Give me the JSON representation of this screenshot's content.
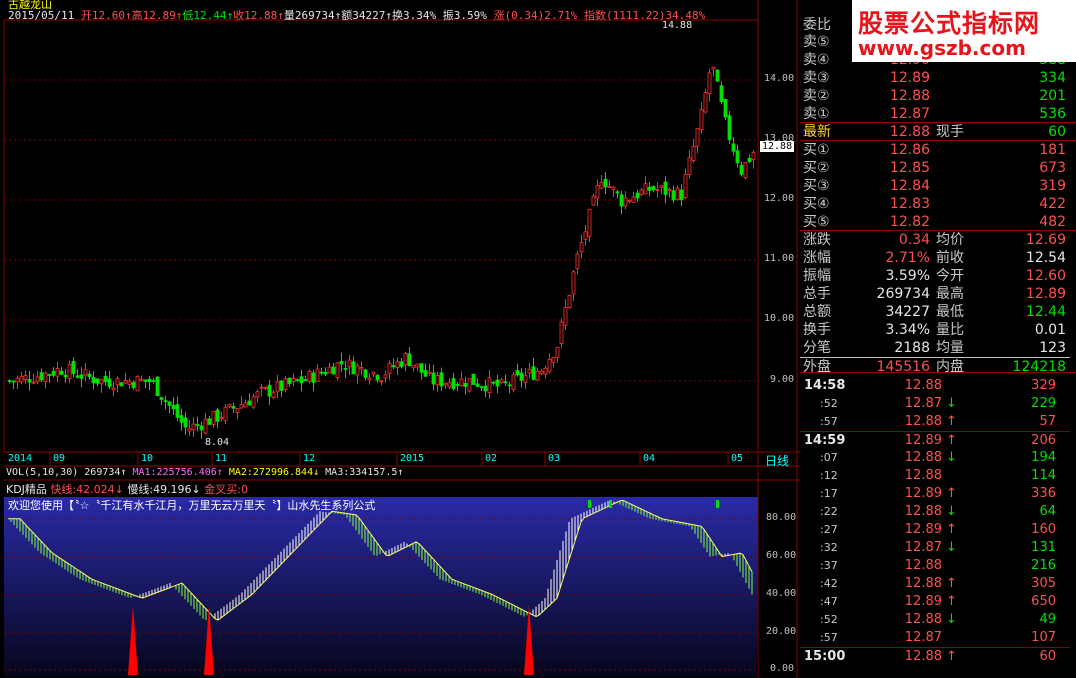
{
  "app_title": "古越龙山",
  "quote_line": {
    "date": "2015/05/11",
    "open": "开12.60↑",
    "high": "高12.89↑",
    "low": "低12.44↑",
    "close": "收12.88↑",
    "volume": "量269734↑",
    "amount": "额34227↑",
    "turnover": "换3.34%",
    "amplitude": "振3.59%",
    "change": "涨(0.34)2.71%",
    "index": "指数(1111.22)34.48%"
  },
  "chart": {
    "price_axis": [
      "14.00",
      "13.00",
      "12.00",
      "11.00",
      "10.00",
      "9.00"
    ],
    "high_label": "14.88",
    "low_label": "8.04",
    "last_price_tag": "12.88",
    "time_axis": [
      "2014",
      "09",
      "10",
      "11",
      "12",
      "2015",
      "02",
      "03",
      "04",
      "05"
    ],
    "period_label": "日线",
    "kdj_axis": [
      "80.00",
      "60.00",
      "40.00",
      "20.00",
      "0.00"
    ]
  },
  "vol_line": {
    "name": "VOL(5,10,30)",
    "vol": "269734↑",
    "ma1": "MA1:225756.406↑",
    "ma2": "MA2:272996.844↓",
    "ma3": "MA3:334157.5↑"
  },
  "kdj_line": {
    "name": "KDJ精品",
    "fast": "快线:42.024↓",
    "slow": "慢线:49.196↓",
    "cross": "金叉买:0"
  },
  "welcome_text": "欢迎您使用【〝☆〝千江有水千江月，万里无云万里天〝】山水先生系列公式",
  "watermark": {
    "line1": "股票公式指标网",
    "line2": "www.gszb.com"
  },
  "order_book": {
    "header": "委比",
    "asks": [
      {
        "label": "卖⑤",
        "price": "",
        "qty": ""
      },
      {
        "label": "卖④",
        "price": "12.90",
        "qty": "388"
      },
      {
        "label": "卖③",
        "price": "12.89",
        "qty": "334"
      },
      {
        "label": "卖②",
        "price": "12.88",
        "qty": "201"
      },
      {
        "label": "卖①",
        "price": "12.87",
        "qty": "536"
      }
    ],
    "latest": {
      "label": "最新",
      "price": "12.88",
      "label2": "现手",
      "qty": "60"
    },
    "bids": [
      {
        "label": "买①",
        "price": "12.86",
        "qty": "181"
      },
      {
        "label": "买②",
        "price": "12.85",
        "qty": "673"
      },
      {
        "label": "买③",
        "price": "12.84",
        "qty": "319"
      },
      {
        "label": "买④",
        "price": "12.83",
        "qty": "422"
      },
      {
        "label": "买⑤",
        "price": "12.82",
        "qty": "482"
      }
    ]
  },
  "stats": [
    {
      "l1": "涨跌",
      "v1": "0.34",
      "c1": "red",
      "l2": "均价",
      "v2": "12.69",
      "c2": "red"
    },
    {
      "l1": "涨幅",
      "v1": "2.71%",
      "c1": "red",
      "l2": "前收",
      "v2": "12.54",
      "c2": "wht"
    },
    {
      "l1": "振幅",
      "v1": "3.59%",
      "c1": "wht",
      "l2": "今开",
      "v2": "12.60",
      "c2": "red"
    },
    {
      "l1": "总手",
      "v1": "269734",
      "c1": "wht",
      "l2": "最高",
      "v2": "12.89",
      "c2": "red"
    },
    {
      "l1": "总额",
      "v1": "34227",
      "c1": "wht",
      "l2": "最低",
      "v2": "12.44",
      "c2": "grn"
    },
    {
      "l1": "换手",
      "v1": "3.34%",
      "c1": "wht",
      "l2": "量比",
      "v2": "0.01",
      "c2": "wht"
    },
    {
      "l1": "分笔",
      "v1": "2188",
      "c1": "wht",
      "l2": "均量",
      "v2": "123",
      "c2": "wht"
    },
    {
      "l1": "外盘",
      "v1": "145516",
      "c1": "red",
      "l2": "内盘",
      "v2": "124218",
      "c2": "grn"
    }
  ],
  "ticks": [
    {
      "time": "14:58",
      "major": true,
      "price": "12.88",
      "arrow": "",
      "qty": "329",
      "pc": "red",
      "qc": "red"
    },
    {
      "time": ":52",
      "major": false,
      "price": "12.87",
      "arrow": "↓",
      "qty": "229",
      "pc": "red",
      "qc": "grn"
    },
    {
      "time": ":57",
      "major": false,
      "price": "12.88",
      "arrow": "↑",
      "qty": "57",
      "pc": "red",
      "qc": "red"
    },
    {
      "time": "14:59",
      "major": true,
      "price": "12.89",
      "arrow": "↑",
      "qty": "206",
      "pc": "red",
      "qc": "red"
    },
    {
      "time": ":07",
      "major": false,
      "price": "12.88",
      "arrow": "↓",
      "qty": "194",
      "pc": "red",
      "qc": "grn"
    },
    {
      "time": ":12",
      "major": false,
      "price": "12.88",
      "arrow": "",
      "qty": "114",
      "pc": "red",
      "qc": "grn"
    },
    {
      "time": ":17",
      "major": false,
      "price": "12.89",
      "arrow": "↑",
      "qty": "336",
      "pc": "red",
      "qc": "red"
    },
    {
      "time": ":22",
      "major": false,
      "price": "12.88",
      "arrow": "↓",
      "qty": "64",
      "pc": "red",
      "qc": "grn"
    },
    {
      "time": ":27",
      "major": false,
      "price": "12.89",
      "arrow": "↑",
      "qty": "160",
      "pc": "red",
      "qc": "red"
    },
    {
      "time": ":32",
      "major": false,
      "price": "12.87",
      "arrow": "↓",
      "qty": "131",
      "pc": "red",
      "qc": "grn"
    },
    {
      "time": ":37",
      "major": false,
      "price": "12.88",
      "arrow": "",
      "qty": "216",
      "pc": "red",
      "qc": "grn"
    },
    {
      "time": ":42",
      "major": false,
      "price": "12.88",
      "arrow": "↑",
      "qty": "305",
      "pc": "red",
      "qc": "red"
    },
    {
      "time": ":47",
      "major": false,
      "price": "12.89",
      "arrow": "↑",
      "qty": "650",
      "pc": "red",
      "qc": "red"
    },
    {
      "time": ":52",
      "major": false,
      "price": "12.88",
      "arrow": "↓",
      "qty": "49",
      "pc": "red",
      "qc": "grn"
    },
    {
      "time": ":57",
      "major": false,
      "price": "12.87",
      "arrow": "",
      "qty": "107",
      "pc": "red",
      "qc": "red"
    },
    {
      "time": "15:00",
      "major": true,
      "price": "12.88",
      "arrow": "↑",
      "qty": "60",
      "pc": "red",
      "qc": "red"
    }
  ]
}
